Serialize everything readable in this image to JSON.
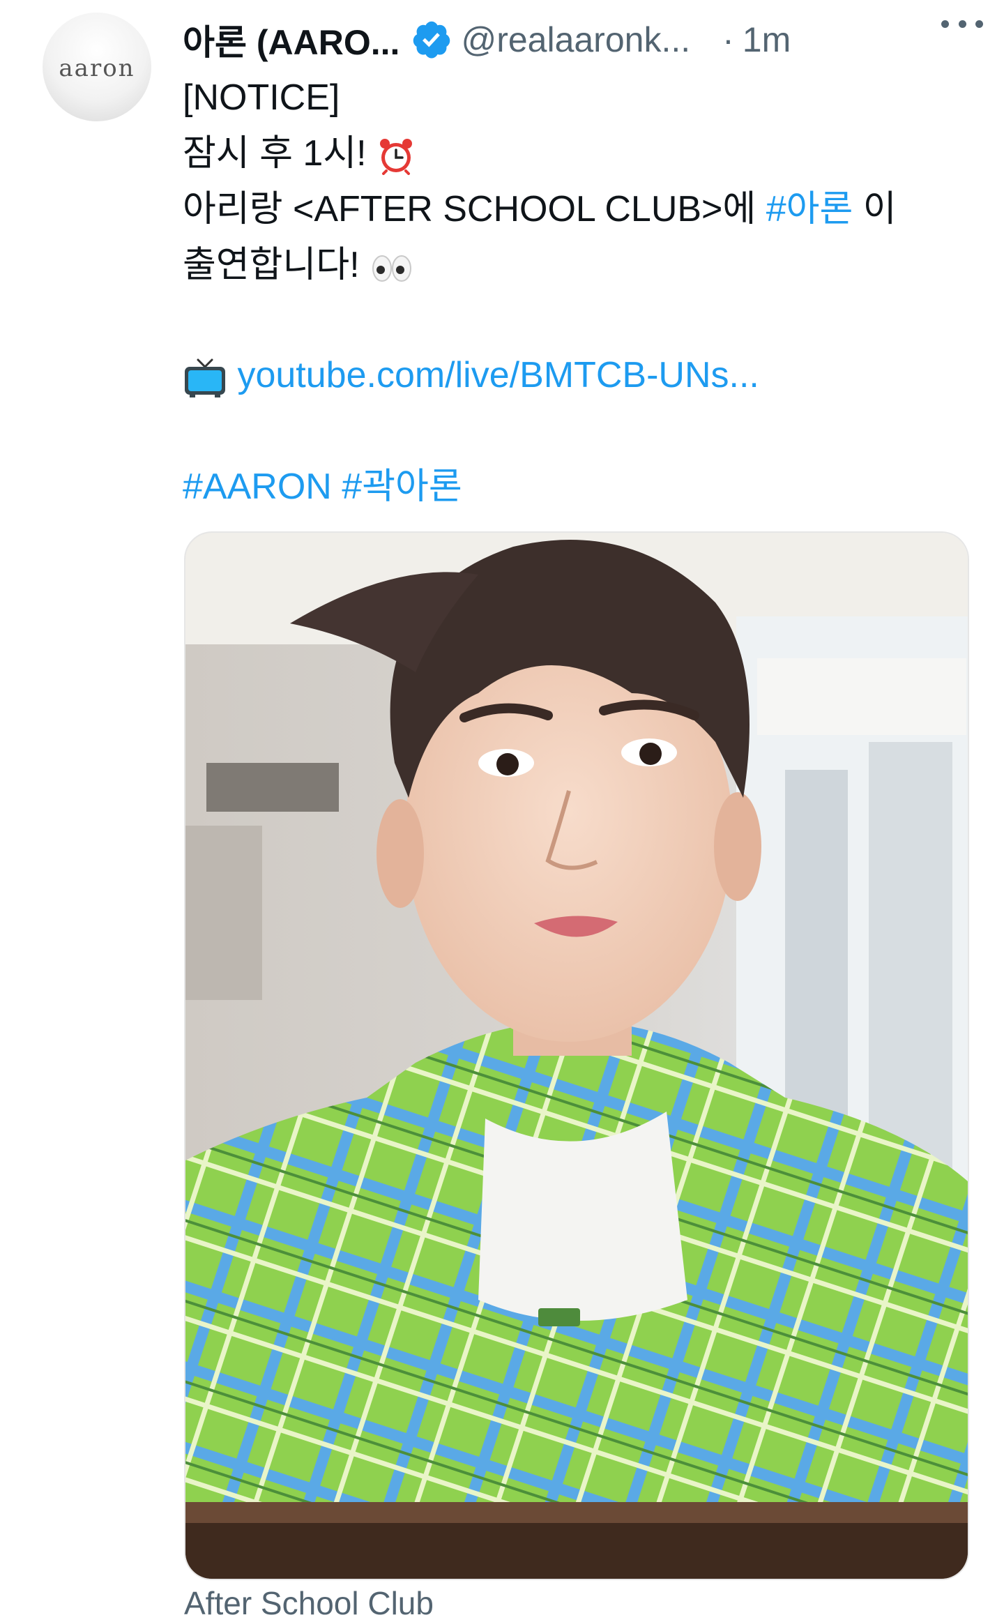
{
  "tweet": {
    "avatar_text": "aaron",
    "author_name": "아론 (AARO...",
    "handle": "@realaaronk...",
    "separator": "·",
    "time": "1m",
    "lines": {
      "notice": "[NOTICE]",
      "soon": "잠시 후 1시!",
      "line3_prefix": "아리랑 <AFTER SCHOOL CLUB>에 ",
      "hashtag_aaron_kr": "#아론",
      "line3_suffix": " 이",
      "line4": "출연합니다!",
      "link": "youtube.com/live/BMTCB-UNs...",
      "hashtag_aaron": "#AARON",
      "hashtag_kwak": "#곽아론"
    },
    "media_caption": "After School Club"
  },
  "colors": {
    "link": "#1d9bf0",
    "muted": "#536471",
    "text": "#0f1419"
  },
  "icons": [
    "verified-badge-icon",
    "more-options-icon",
    "alarm-clock-icon",
    "eyes-icon",
    "tv-icon"
  ]
}
